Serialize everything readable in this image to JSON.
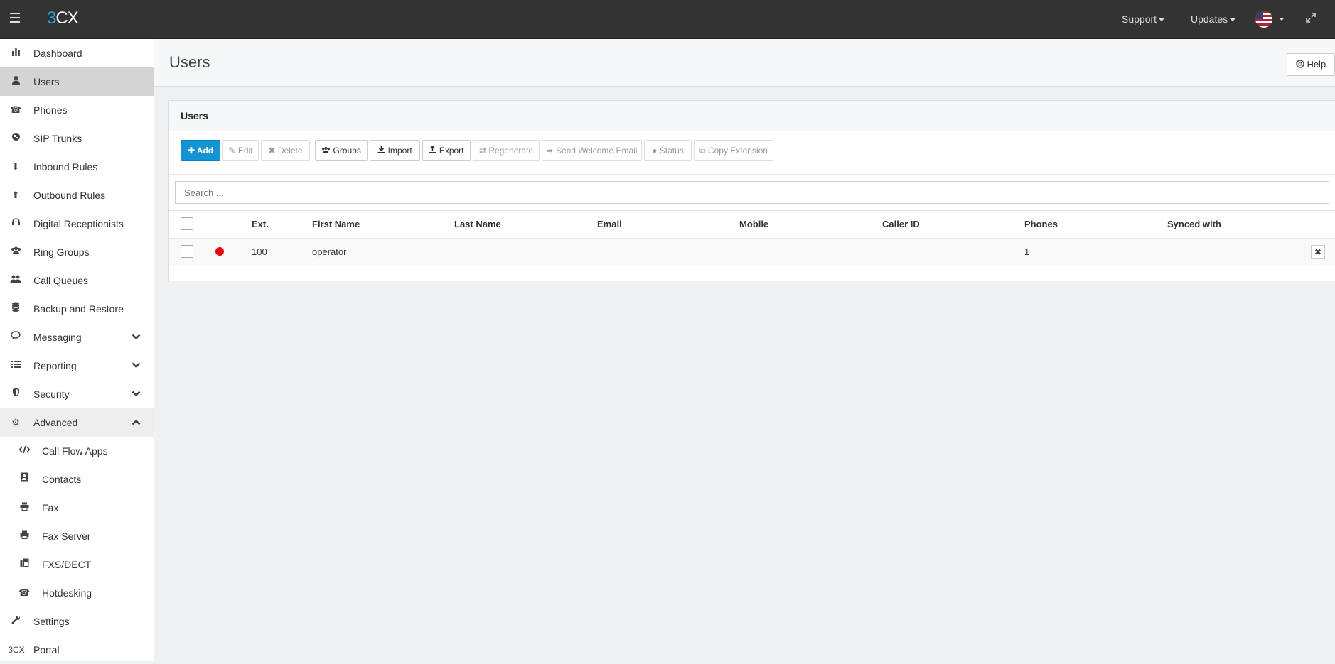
{
  "topbar": {
    "logo_three": "3",
    "logo_cx": "CX",
    "support_label": "Support",
    "updates_label": "Updates"
  },
  "sidebar": {
    "items": [
      {
        "label": "Dashboard"
      },
      {
        "label": "Users"
      },
      {
        "label": "Phones"
      },
      {
        "label": "SIP Trunks"
      },
      {
        "label": "Inbound Rules"
      },
      {
        "label": "Outbound Rules"
      },
      {
        "label": "Digital Receptionists"
      },
      {
        "label": "Ring Groups"
      },
      {
        "label": "Call Queues"
      },
      {
        "label": "Backup and Restore"
      },
      {
        "label": "Messaging"
      },
      {
        "label": "Reporting"
      },
      {
        "label": "Security"
      },
      {
        "label": "Advanced"
      },
      {
        "label": "Call Flow Apps"
      },
      {
        "label": "Contacts"
      },
      {
        "label": "Fax"
      },
      {
        "label": "Fax Server"
      },
      {
        "label": "FXS/DECT"
      },
      {
        "label": "Hotdesking"
      },
      {
        "label": "Settings"
      },
      {
        "label": "Portal"
      }
    ],
    "portal_icon_text": "3CX"
  },
  "header": {
    "title": "Users",
    "help_label": "Help"
  },
  "panel": {
    "title": "Users"
  },
  "toolbar": {
    "add": "Add",
    "edit": "Edit",
    "delete": "Delete",
    "groups": "Groups",
    "import": "Import",
    "export": "Export",
    "regenerate": "Regenerate",
    "send_welcome": "Send Welcome Email",
    "status": "Status",
    "copy_extension": "Copy Extension"
  },
  "search": {
    "placeholder": "Search ..."
  },
  "table": {
    "columns": {
      "ext": "Ext.",
      "first_name": "First Name",
      "last_name": "Last Name",
      "email": "Email",
      "mobile": "Mobile",
      "caller_id": "Caller ID",
      "phones": "Phones",
      "synced_with": "Synced with"
    },
    "rows": [
      {
        "status_color": "#e60000",
        "ext": "100",
        "first_name": "operator",
        "last_name": "",
        "email": "",
        "mobile": "",
        "caller_id": "",
        "phones": "1",
        "synced_with": ""
      }
    ]
  },
  "colors": {
    "topbar": "#333333",
    "primary": "#1193d4",
    "brand_three": "#29a3dd"
  }
}
